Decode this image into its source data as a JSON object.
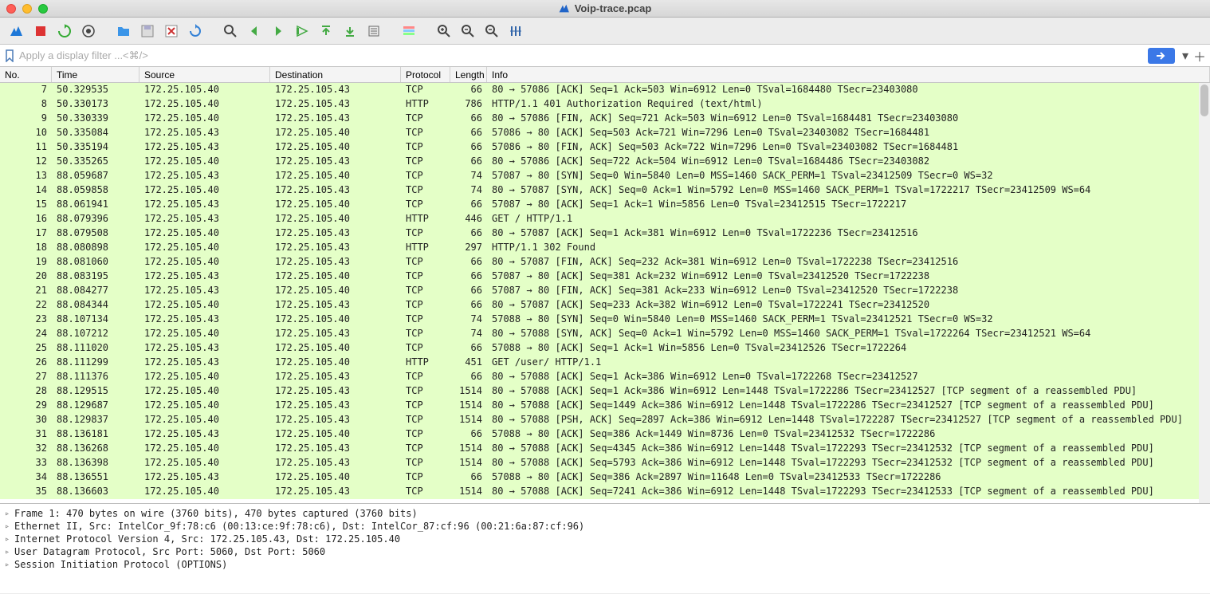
{
  "title": "Voip-trace.pcap",
  "filter_placeholder": "Apply a display filter ...<⌘/>",
  "headers": {
    "no": "No.",
    "time": "Time",
    "source": "Source",
    "destination": "Destination",
    "protocol": "Protocol",
    "length": "Length",
    "info": "Info"
  },
  "colors": {
    "http_row": "#e4ffc7",
    "tcp_row": "#e4ffc7"
  },
  "packets": [
    {
      "no": 7,
      "time": "50.329535",
      "src": "172.25.105.40",
      "dst": "172.25.105.43",
      "proto": "TCP",
      "len": 66,
      "info": "80 → 57086 [ACK] Seq=1 Ack=503 Win=6912 Len=0 TSval=1684480 TSecr=23403080"
    },
    {
      "no": 8,
      "time": "50.330173",
      "src": "172.25.105.40",
      "dst": "172.25.105.43",
      "proto": "HTTP",
      "len": 786,
      "info": "HTTP/1.1 401 Authorization Required  (text/html)"
    },
    {
      "no": 9,
      "time": "50.330339",
      "src": "172.25.105.40",
      "dst": "172.25.105.43",
      "proto": "TCP",
      "len": 66,
      "info": "80 → 57086 [FIN, ACK] Seq=721 Ack=503 Win=6912 Len=0 TSval=1684481 TSecr=23403080"
    },
    {
      "no": 10,
      "time": "50.335084",
      "src": "172.25.105.43",
      "dst": "172.25.105.40",
      "proto": "TCP",
      "len": 66,
      "info": "57086 → 80 [ACK] Seq=503 Ack=721 Win=7296 Len=0 TSval=23403082 TSecr=1684481"
    },
    {
      "no": 11,
      "time": "50.335194",
      "src": "172.25.105.43",
      "dst": "172.25.105.40",
      "proto": "TCP",
      "len": 66,
      "info": "57086 → 80 [FIN, ACK] Seq=503 Ack=722 Win=7296 Len=0 TSval=23403082 TSecr=1684481"
    },
    {
      "no": 12,
      "time": "50.335265",
      "src": "172.25.105.40",
      "dst": "172.25.105.43",
      "proto": "TCP",
      "len": 66,
      "info": "80 → 57086 [ACK] Seq=722 Ack=504 Win=6912 Len=0 TSval=1684486 TSecr=23403082"
    },
    {
      "no": 13,
      "time": "88.059687",
      "src": "172.25.105.43",
      "dst": "172.25.105.40",
      "proto": "TCP",
      "len": 74,
      "info": "57087 → 80 [SYN] Seq=0 Win=5840 Len=0 MSS=1460 SACK_PERM=1 TSval=23412509 TSecr=0 WS=32"
    },
    {
      "no": 14,
      "time": "88.059858",
      "src": "172.25.105.40",
      "dst": "172.25.105.43",
      "proto": "TCP",
      "len": 74,
      "info": "80 → 57087 [SYN, ACK] Seq=0 Ack=1 Win=5792 Len=0 MSS=1460 SACK_PERM=1 TSval=1722217 TSecr=23412509 WS=64"
    },
    {
      "no": 15,
      "time": "88.061941",
      "src": "172.25.105.43",
      "dst": "172.25.105.40",
      "proto": "TCP",
      "len": 66,
      "info": "57087 → 80 [ACK] Seq=1 Ack=1 Win=5856 Len=0 TSval=23412515 TSecr=1722217"
    },
    {
      "no": 16,
      "time": "88.079396",
      "src": "172.25.105.43",
      "dst": "172.25.105.40",
      "proto": "HTTP",
      "len": 446,
      "info": "GET / HTTP/1.1"
    },
    {
      "no": 17,
      "time": "88.079508",
      "src": "172.25.105.40",
      "dst": "172.25.105.43",
      "proto": "TCP",
      "len": 66,
      "info": "80 → 57087 [ACK] Seq=1 Ack=381 Win=6912 Len=0 TSval=1722236 TSecr=23412516"
    },
    {
      "no": 18,
      "time": "88.080898",
      "src": "172.25.105.40",
      "dst": "172.25.105.43",
      "proto": "HTTP",
      "len": 297,
      "info": "HTTP/1.1 302 Found"
    },
    {
      "no": 19,
      "time": "88.081060",
      "src": "172.25.105.40",
      "dst": "172.25.105.43",
      "proto": "TCP",
      "len": 66,
      "info": "80 → 57087 [FIN, ACK] Seq=232 Ack=381 Win=6912 Len=0 TSval=1722238 TSecr=23412516"
    },
    {
      "no": 20,
      "time": "88.083195",
      "src": "172.25.105.43",
      "dst": "172.25.105.40",
      "proto": "TCP",
      "len": 66,
      "info": "57087 → 80 [ACK] Seq=381 Ack=232 Win=6912 Len=0 TSval=23412520 TSecr=1722238"
    },
    {
      "no": 21,
      "time": "88.084277",
      "src": "172.25.105.43",
      "dst": "172.25.105.40",
      "proto": "TCP",
      "len": 66,
      "info": "57087 → 80 [FIN, ACK] Seq=381 Ack=233 Win=6912 Len=0 TSval=23412520 TSecr=1722238"
    },
    {
      "no": 22,
      "time": "88.084344",
      "src": "172.25.105.40",
      "dst": "172.25.105.43",
      "proto": "TCP",
      "len": 66,
      "info": "80 → 57087 [ACK] Seq=233 Ack=382 Win=6912 Len=0 TSval=1722241 TSecr=23412520"
    },
    {
      "no": 23,
      "time": "88.107134",
      "src": "172.25.105.43",
      "dst": "172.25.105.40",
      "proto": "TCP",
      "len": 74,
      "info": "57088 → 80 [SYN] Seq=0 Win=5840 Len=0 MSS=1460 SACK_PERM=1 TSval=23412521 TSecr=0 WS=32"
    },
    {
      "no": 24,
      "time": "88.107212",
      "src": "172.25.105.40",
      "dst": "172.25.105.43",
      "proto": "TCP",
      "len": 74,
      "info": "80 → 57088 [SYN, ACK] Seq=0 Ack=1 Win=5792 Len=0 MSS=1460 SACK_PERM=1 TSval=1722264 TSecr=23412521 WS=64"
    },
    {
      "no": 25,
      "time": "88.111020",
      "src": "172.25.105.43",
      "dst": "172.25.105.40",
      "proto": "TCP",
      "len": 66,
      "info": "57088 → 80 [ACK] Seq=1 Ack=1 Win=5856 Len=0 TSval=23412526 TSecr=1722264"
    },
    {
      "no": 26,
      "time": "88.111299",
      "src": "172.25.105.43",
      "dst": "172.25.105.40",
      "proto": "HTTP",
      "len": 451,
      "info": "GET /user/ HTTP/1.1"
    },
    {
      "no": 27,
      "time": "88.111376",
      "src": "172.25.105.40",
      "dst": "172.25.105.43",
      "proto": "TCP",
      "len": 66,
      "info": "80 → 57088 [ACK] Seq=1 Ack=386 Win=6912 Len=0 TSval=1722268 TSecr=23412527"
    },
    {
      "no": 28,
      "time": "88.129515",
      "src": "172.25.105.40",
      "dst": "172.25.105.43",
      "proto": "TCP",
      "len": 1514,
      "info": "80 → 57088 [ACK] Seq=1 Ack=386 Win=6912 Len=1448 TSval=1722286 TSecr=23412527 [TCP segment of a reassembled PDU]"
    },
    {
      "no": 29,
      "time": "88.129687",
      "src": "172.25.105.40",
      "dst": "172.25.105.43",
      "proto": "TCP",
      "len": 1514,
      "info": "80 → 57088 [ACK] Seq=1449 Ack=386 Win=6912 Len=1448 TSval=1722286 TSecr=23412527 [TCP segment of a reassembled PDU]"
    },
    {
      "no": 30,
      "time": "88.129837",
      "src": "172.25.105.40",
      "dst": "172.25.105.43",
      "proto": "TCP",
      "len": 1514,
      "info": "80 → 57088 [PSH, ACK] Seq=2897 Ack=386 Win=6912 Len=1448 TSval=1722287 TSecr=23412527 [TCP segment of a reassembled PDU]"
    },
    {
      "no": 31,
      "time": "88.136181",
      "src": "172.25.105.43",
      "dst": "172.25.105.40",
      "proto": "TCP",
      "len": 66,
      "info": "57088 → 80 [ACK] Seq=386 Ack=1449 Win=8736 Len=0 TSval=23412532 TSecr=1722286"
    },
    {
      "no": 32,
      "time": "88.136268",
      "src": "172.25.105.40",
      "dst": "172.25.105.43",
      "proto": "TCP",
      "len": 1514,
      "info": "80 → 57088 [ACK] Seq=4345 Ack=386 Win=6912 Len=1448 TSval=1722293 TSecr=23412532 [TCP segment of a reassembled PDU]"
    },
    {
      "no": 33,
      "time": "88.136398",
      "src": "172.25.105.40",
      "dst": "172.25.105.43",
      "proto": "TCP",
      "len": 1514,
      "info": "80 → 57088 [ACK] Seq=5793 Ack=386 Win=6912 Len=1448 TSval=1722293 TSecr=23412532 [TCP segment of a reassembled PDU]"
    },
    {
      "no": 34,
      "time": "88.136551",
      "src": "172.25.105.43",
      "dst": "172.25.105.40",
      "proto": "TCP",
      "len": 66,
      "info": "57088 → 80 [ACK] Seq=386 Ack=2897 Win=11648 Len=0 TSval=23412533 TSecr=1722286"
    },
    {
      "no": 35,
      "time": "88.136603",
      "src": "172.25.105.40",
      "dst": "172.25.105.43",
      "proto": "TCP",
      "len": 1514,
      "info": "80 → 57088 [ACK] Seq=7241 Ack=386 Win=6912 Len=1448 TSval=1722293 TSecr=23412533 [TCP segment of a reassembled PDU]"
    }
  ],
  "details": [
    "Frame 1: 470 bytes on wire (3760 bits), 470 bytes captured (3760 bits)",
    "Ethernet II, Src: IntelCor_9f:78:c6 (00:13:ce:9f:78:c6), Dst: IntelCor_87:cf:96 (00:21:6a:87:cf:96)",
    "Internet Protocol Version 4, Src: 172.25.105.43, Dst: 172.25.105.40",
    "User Datagram Protocol, Src Port: 5060, Dst Port: 5060",
    "Session Initiation Protocol (OPTIONS)"
  ]
}
